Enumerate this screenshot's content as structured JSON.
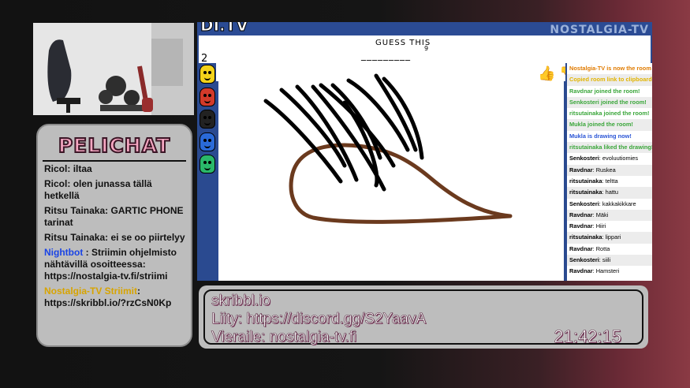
{
  "colors": {
    "pelichat_title": "#f6a7c2",
    "game_blue": "#2a4a90",
    "nightbot_blue": "#1a44e6",
    "striimit_gold": "#d8a400",
    "brown_stroke": "#6b3a1e"
  },
  "pelichat": {
    "title": "PELICHAT",
    "messages": [
      {
        "user": "Ricol",
        "sep": ": ",
        "text": "iltaa",
        "name_color": "default"
      },
      {
        "user": "Ricol",
        "sep": ": ",
        "text": "olen junassa tällä hetkellä",
        "name_color": "default"
      },
      {
        "user": "Ritsu Tainaka",
        "sep": ": ",
        "text": "GARTIC PHONE tarinat",
        "name_color": "default"
      },
      {
        "user": "Ritsu Tainaka",
        "sep": ": ",
        "text": "ei se oo piirtelyy",
        "name_color": "default"
      },
      {
        "user": "Nightbot",
        "sep": " : ",
        "text": "Striimin ohjelmisto nähtävillä osoitteessa: https://nostalgia-tv.fi/striimi",
        "name_color": "blue"
      },
      {
        "user": "Nostalgia-TV Striimit",
        "sep": ": ",
        "text": "https://skribbl.io/?rzCsN0Kp",
        "name_color": "gold"
      }
    ]
  },
  "game": {
    "logo": "DI.TV",
    "brand": "NOSTALGIA-TV",
    "round": "2",
    "guess_label": "GUESS THIS",
    "word_blanks": "_________",
    "word_length": "9",
    "players": [
      {
        "color": "#f3d21a",
        "icon": "yellow-avatar-icon"
      },
      {
        "color": "#d23a2a",
        "icon": "red-avatar-icon"
      },
      {
        "color": "#222222",
        "icon": "black-avatar-icon"
      },
      {
        "color": "#2a6ad8",
        "icon": "blue-avatar-icon"
      },
      {
        "color": "#2ab86a",
        "icon": "green-avatar-icon"
      }
    ],
    "chat": [
      {
        "user": "",
        "text": "Nostalgia-TV is now the room owner",
        "style": "orange"
      },
      {
        "user": "",
        "text": "Copied room link to clipboard",
        "style": "yellow"
      },
      {
        "user": "",
        "text": "Ravdnar joined the room!",
        "style": "green"
      },
      {
        "user": "",
        "text": "Senkosteri joined the room!",
        "style": "green"
      },
      {
        "user": "",
        "text": "ritsutainaka joined the room!",
        "style": "green"
      },
      {
        "user": "",
        "text": "Mukla joined the room!",
        "style": "green"
      },
      {
        "user": "",
        "text": "Mukla is drawing now!",
        "style": "blue"
      },
      {
        "user": "",
        "text": "ritsutainaka liked the drawing!",
        "style": "green"
      },
      {
        "user": "Senkosteri",
        "text": "evoluutiomies",
        "style": "normal"
      },
      {
        "user": "Ravdnar",
        "text": "Ruskea",
        "style": "normal"
      },
      {
        "user": "ritsutainaka",
        "text": "teltta",
        "style": "normal"
      },
      {
        "user": "ritsutainaka",
        "text": "hattu",
        "style": "normal"
      },
      {
        "user": "Senkosteri",
        "text": "kakkakikkare",
        "style": "normal"
      },
      {
        "user": "Ravdnar",
        "text": "Mäki",
        "style": "normal"
      },
      {
        "user": "Ravdnar",
        "text": "Hiiri",
        "style": "normal"
      },
      {
        "user": "ritsutainaka",
        "text": "lippari",
        "style": "normal"
      },
      {
        "user": "Ravdnar",
        "text": "Rotta",
        "style": "normal"
      },
      {
        "user": "Senkosteri",
        "text": "siili",
        "style": "normal"
      },
      {
        "user": "Ravdnar",
        "text": "Hamsteri",
        "style": "normal"
      }
    ]
  },
  "info": {
    "line1": "skribbl.io",
    "line2": "Liity: https://discord.gg/S2YaavA",
    "line3": "Vieraile: nostalgia-tv.fi",
    "clock": "21:42:15"
  }
}
